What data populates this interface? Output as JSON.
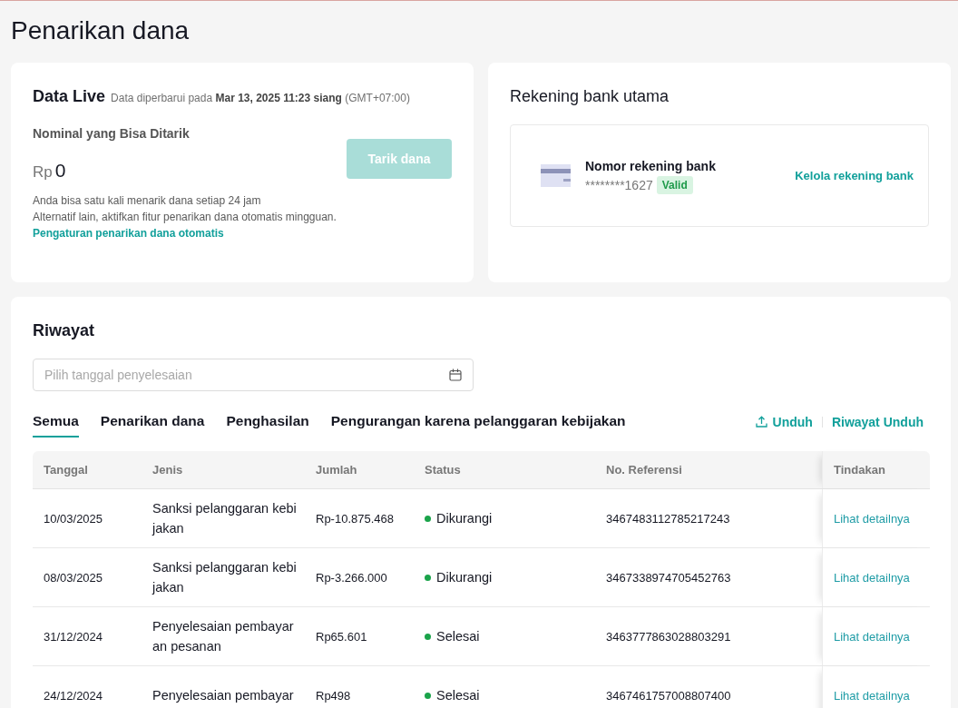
{
  "page": {
    "title": "Penarikan dana"
  },
  "live_data": {
    "title": "Data Live",
    "updated_note": "Data diperbarui pada **Mar 13, 2025 11:23 siang** (GMT+07:00)",
    "balance_label": "Nominal yang Bisa Ditarik",
    "currency": "Rp",
    "amount": "0",
    "withdraw_button": {
      "label": "Tarik dana",
      "disabled": true
    },
    "limit_note": "Anda bisa satu kali menarik dana setiap 24 jam",
    "auto_note": "Alternatif lain, aktifkan fitur penarikan dana otomatis mingguan.",
    "auto_link": "Pengaturan penarikan dana otomatis"
  },
  "bank_account": {
    "title": "Rekening bank utama",
    "label": "Nomor rekening bank",
    "number": "********1627",
    "badge": "Valid",
    "manage_link": "Kelola rekening bank"
  },
  "history": {
    "title": "Riwayat",
    "date_filter": {
      "placeholder": "Pilih tanggal penyelesaian"
    },
    "tabs": [
      {
        "label": "Semua",
        "selected": true
      },
      {
        "label": "Penarikan dana",
        "selected": false
      },
      {
        "label": "Penghasilan",
        "selected": false
      },
      {
        "label": "Pengurangan karena pelanggaran kebijakan",
        "selected": false
      }
    ],
    "download_button": "Unduh",
    "download_history_link": "Riwayat Unduh",
    "table": {
      "columns": [
        "Tanggal",
        "Jenis",
        "Jumlah",
        "Status",
        "No. Referensi",
        "Tindakan"
      ],
      "rows": [
        {
          "date": "10/03/2025",
          "type": "Sanksi pelanggaran kebijakan",
          "amount": "Rp-10.875.468",
          "status": "Dikurangi",
          "reference": "3467483112785217243",
          "action": "Lihat detailnya"
        },
        {
          "date": "08/03/2025",
          "type": "Sanksi pelanggaran kebijakan",
          "amount": "Rp-3.266.000",
          "status": "Dikurangi",
          "reference": "3467338974705452763",
          "action": "Lihat detailnya"
        },
        {
          "date": "31/12/2024",
          "type": "Penyelesaian pembayaran pesanan",
          "amount": "Rp65.601",
          "status": "Selesai",
          "reference": "3463777863028803291",
          "action": "Lihat detailnya"
        },
        {
          "date": "24/12/2024",
          "type": "Penyelesaian pembayar",
          "amount": "Rp498",
          "status": "Selesai",
          "reference": "3467461757008807400",
          "action": "Lihat detailnya"
        }
      ]
    }
  }
}
